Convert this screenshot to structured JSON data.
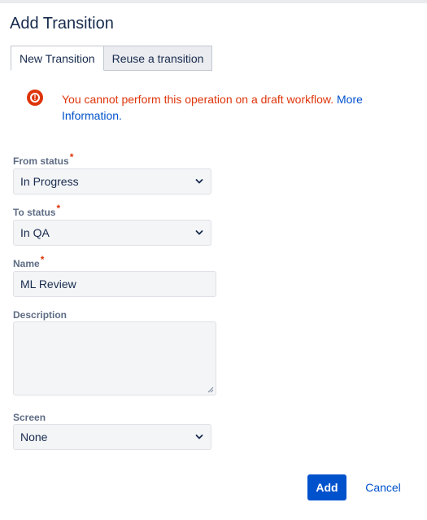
{
  "dialog": {
    "title": "Add Transition"
  },
  "tabs": [
    {
      "label": "New Transition",
      "active": true
    },
    {
      "label": "Reuse a transition",
      "active": false
    }
  ],
  "alert": {
    "icon": "error-icon",
    "message": "You cannot perform this operation on a draft workflow.",
    "link_text": "More Information."
  },
  "form": {
    "required_marker": "*",
    "from_status": {
      "label": "From status",
      "value": "In Progress"
    },
    "to_status": {
      "label": "To status",
      "value": "In QA"
    },
    "name": {
      "label": "Name",
      "value": "ML Review"
    },
    "description": {
      "label": "Description",
      "value": ""
    },
    "screen": {
      "label": "Screen",
      "value": "None"
    }
  },
  "actions": {
    "add_label": "Add",
    "cancel_label": "Cancel"
  },
  "colors": {
    "primary": "#0052cc",
    "error": "#de350b",
    "text": "#172b4d",
    "label": "#5e6c84",
    "field_bg": "#f4f5f7"
  }
}
